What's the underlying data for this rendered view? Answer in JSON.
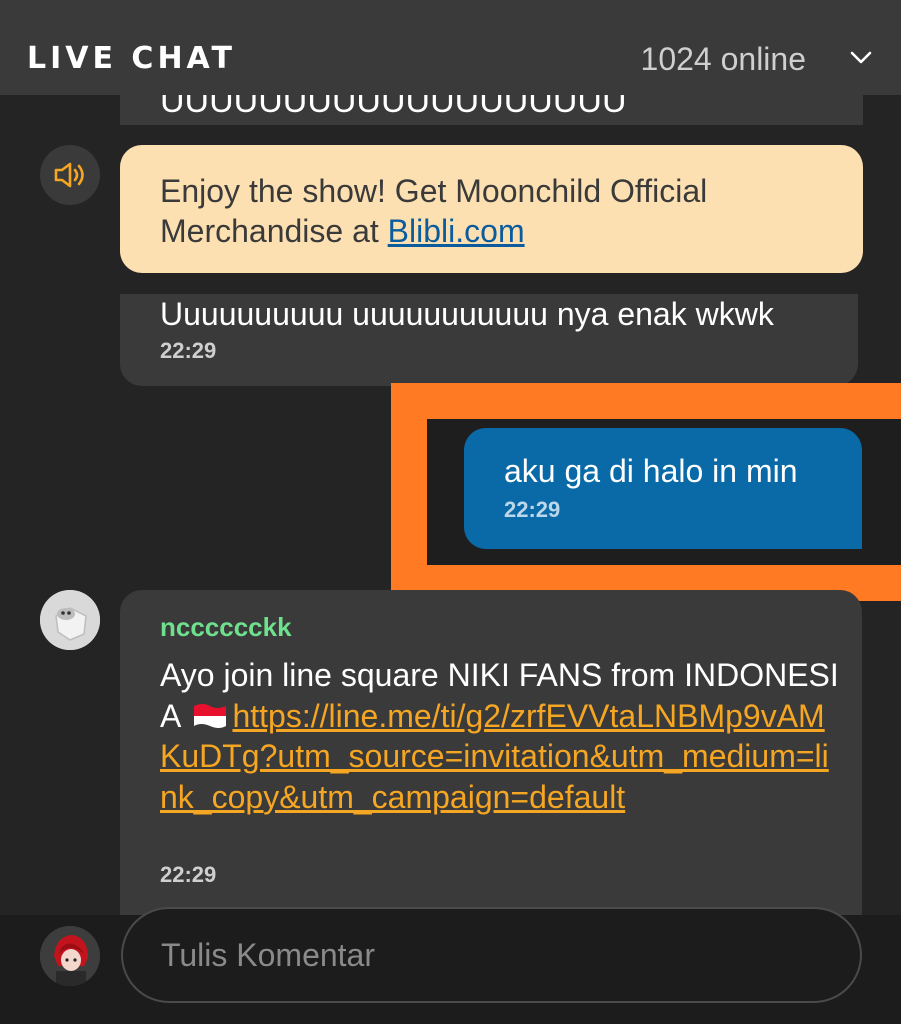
{
  "header": {
    "title": "LIVE CHAT",
    "online": "1024 online",
    "collapse_icon": "chevron-down-icon"
  },
  "messages": [
    {
      "id": "partial",
      "text": "UUUUUUUUUUUUUUUUUUU"
    },
    {
      "id": "announcement",
      "icon": "speaker-icon",
      "text": "Enjoy the show! Get Moonchild Official Merchandise at ",
      "link": "Blibli.com"
    },
    {
      "id": "msg2",
      "text": "Uuuuuuuuuu uuuuuuuuuuu nya enak wkwk",
      "time": "22:29"
    },
    {
      "id": "own",
      "text": "aku ga di halo in min",
      "time": "22:29"
    },
    {
      "id": "msg3",
      "username": "ncccccckk",
      "text": "Ayo join line square NIKI FANS from INDONESIA ",
      "flag": "indonesia-flag",
      "link": "https://line.me/ti/g2/zrfEVVtaLNBMp9vAMKuDTg?utm_source=invitation&utm_medium=link_copy&utm_campaign=default",
      "time": "22:29"
    }
  ],
  "composer": {
    "placeholder": "Tulis Komentar"
  },
  "colors": {
    "background": "#242424",
    "header": "#3a3a3a",
    "bubble": "#3a3a3a",
    "announcement": "#fde0b2",
    "own_bubble": "#0a6aa8",
    "highlight": "#ff7a22",
    "username": "#6fe08e",
    "link": "#f5a623"
  }
}
